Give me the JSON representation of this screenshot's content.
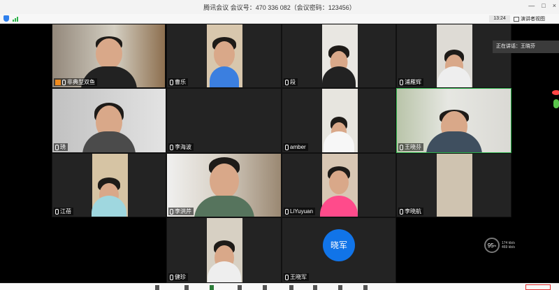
{
  "window": {
    "title": "腾讯会议 会议号：470 336 082（会议密码：123456）",
    "controls": [
      "—",
      "□",
      "×"
    ]
  },
  "status": {
    "time": "13:24",
    "view_label": "演讲者视图"
  },
  "speaking": {
    "label": "正在讲话：王晓芬"
  },
  "participants": [
    {
      "name": "非典型双鱼",
      "host": true
    },
    {
      "name": "曹乐"
    },
    {
      "name": "段"
    },
    {
      "name": "浦雁辉"
    },
    {
      "name": "琇"
    },
    {
      "name": "李海波"
    },
    {
      "name": "amber"
    },
    {
      "name": "王晓芬",
      "active": true
    },
    {
      "name": "江蓓"
    },
    {
      "name": "李洪芹"
    },
    {
      "name": "LiYuyuan"
    },
    {
      "name": "李晓航"
    },
    {
      "name": "健珍"
    },
    {
      "name": "王晓军",
      "avatar_text": "晓军"
    }
  ],
  "network": {
    "quality": "95",
    "unit": "%",
    "upload": "174",
    "download": "469",
    "rate_unit": "kb/s"
  },
  "colors": {
    "active_border": "#2cb14a",
    "avatar_blue": "#1174e8",
    "brand_blue": "#2f80ed",
    "danger_red": "#e52f2f"
  },
  "icons": [
    "shield-icon",
    "signal-icon",
    "mic-icon",
    "host-icon",
    "gallery-view-icon"
  ]
}
